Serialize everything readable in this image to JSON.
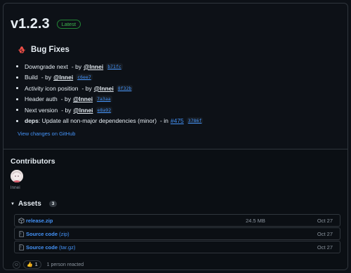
{
  "release": {
    "version": "v1.2.3",
    "badge": "Latest"
  },
  "bugfixes": {
    "title": "Bug Fixes",
    "items": [
      {
        "text": "Downgrade next",
        "by": "- by",
        "user": "@lnnei",
        "sha": "b71fc"
      },
      {
        "text": "Build",
        "by": "- by",
        "user": "@lnnei",
        "sha": "c6ee7"
      },
      {
        "text": "Activity icon position",
        "by": "- by",
        "user": "@lnnei",
        "sha": "8f32b"
      },
      {
        "text": "Header auth",
        "by": "- by",
        "user": "@lnnei",
        "sha": "7a3aa"
      },
      {
        "text": "Next version",
        "by": "- by",
        "user": "@lnnei",
        "sha": "e8a92"
      }
    ],
    "deps": {
      "label": "deps",
      "text": ": Update all non-major dependencies (minor)",
      "in": "- in",
      "pr": "#475",
      "sha": "3786f"
    }
  },
  "github_link": "View changes on GitHub",
  "contributors": {
    "title": "Contributors",
    "name": "lnnei"
  },
  "assets": {
    "title": "Assets",
    "count": "3",
    "rows": [
      {
        "name": "release.zip",
        "suffix": "",
        "size": "24.5 MB",
        "date": "Oct 27",
        "icon": "package-icon"
      },
      {
        "name": "Source code",
        "suffix": " (zip)",
        "size": "",
        "date": "Oct 27",
        "icon": "file-zip-icon"
      },
      {
        "name": "Source code",
        "suffix": " (tar.gz)",
        "size": "",
        "date": "Oct 27",
        "icon": "file-zip-icon"
      }
    ]
  },
  "reactions": {
    "emoji": "👍",
    "count": "1",
    "text": "1 person reacted"
  },
  "colors": {
    "background": "#0d1117",
    "border": "#30363d",
    "link": "#4493f8",
    "latest_green": "#3fb950",
    "muted": "#8b949e"
  }
}
